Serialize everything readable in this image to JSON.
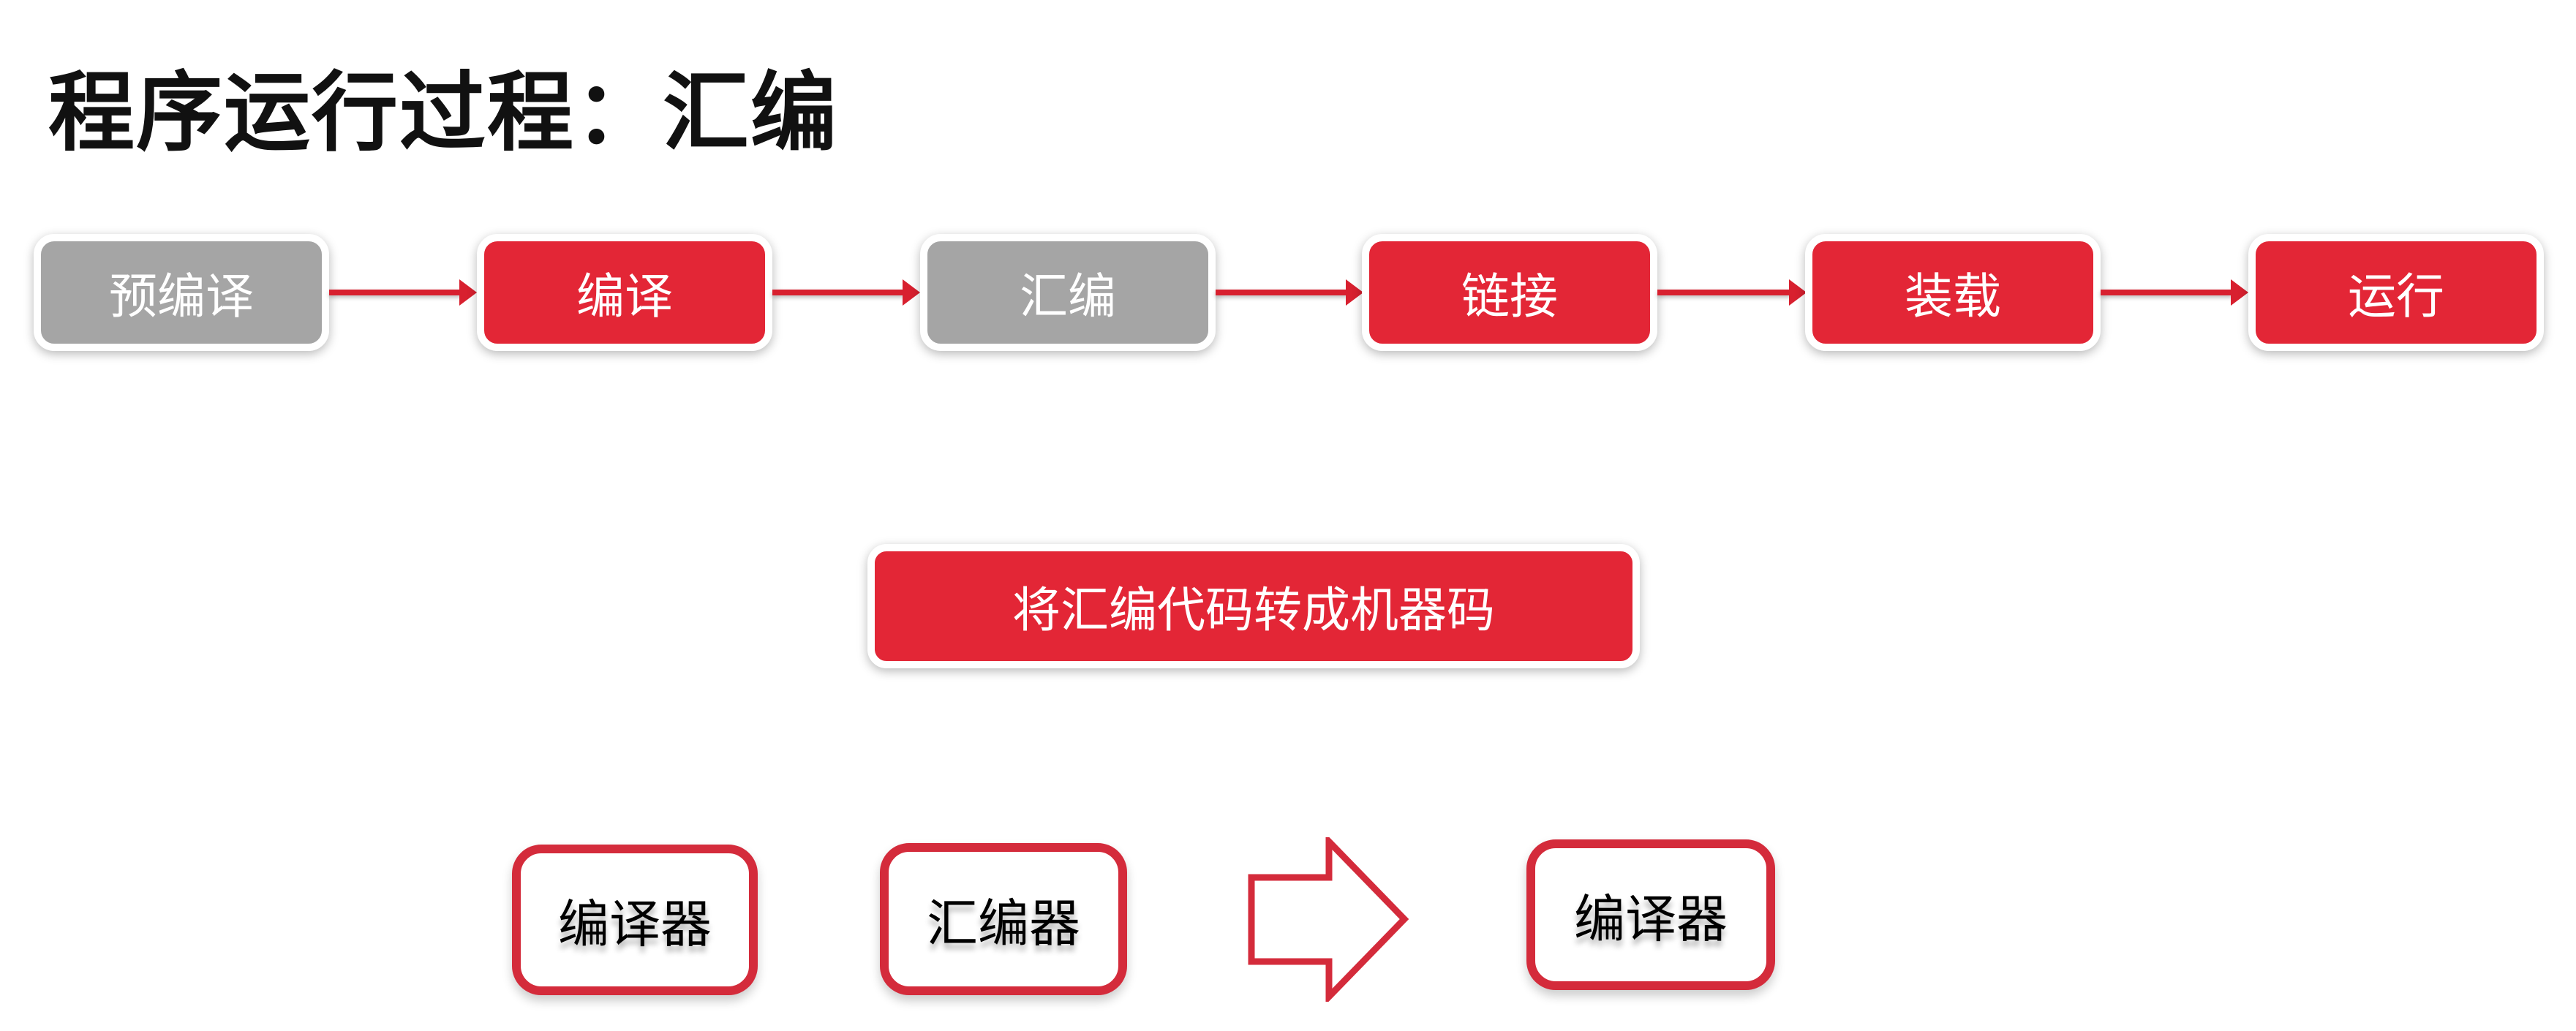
{
  "title": "程序运行过程：汇编",
  "steps": [
    {
      "label": "预编译",
      "state": "inactive"
    },
    {
      "label": "编译",
      "state": "active"
    },
    {
      "label": "汇编",
      "state": "inactive"
    },
    {
      "label": "链接",
      "state": "active"
    },
    {
      "label": "装载",
      "state": "active"
    },
    {
      "label": "运行",
      "state": "active"
    }
  ],
  "description": "将汇编代码转成机器码",
  "tools": {
    "left": [
      "编译器",
      "汇编器"
    ],
    "right": "编译器",
    "arrow_icon": "right-arrow-outline"
  },
  "colors": {
    "active": "#e32636",
    "inactive": "#a5a5a5",
    "outline": "#d42b3b"
  }
}
